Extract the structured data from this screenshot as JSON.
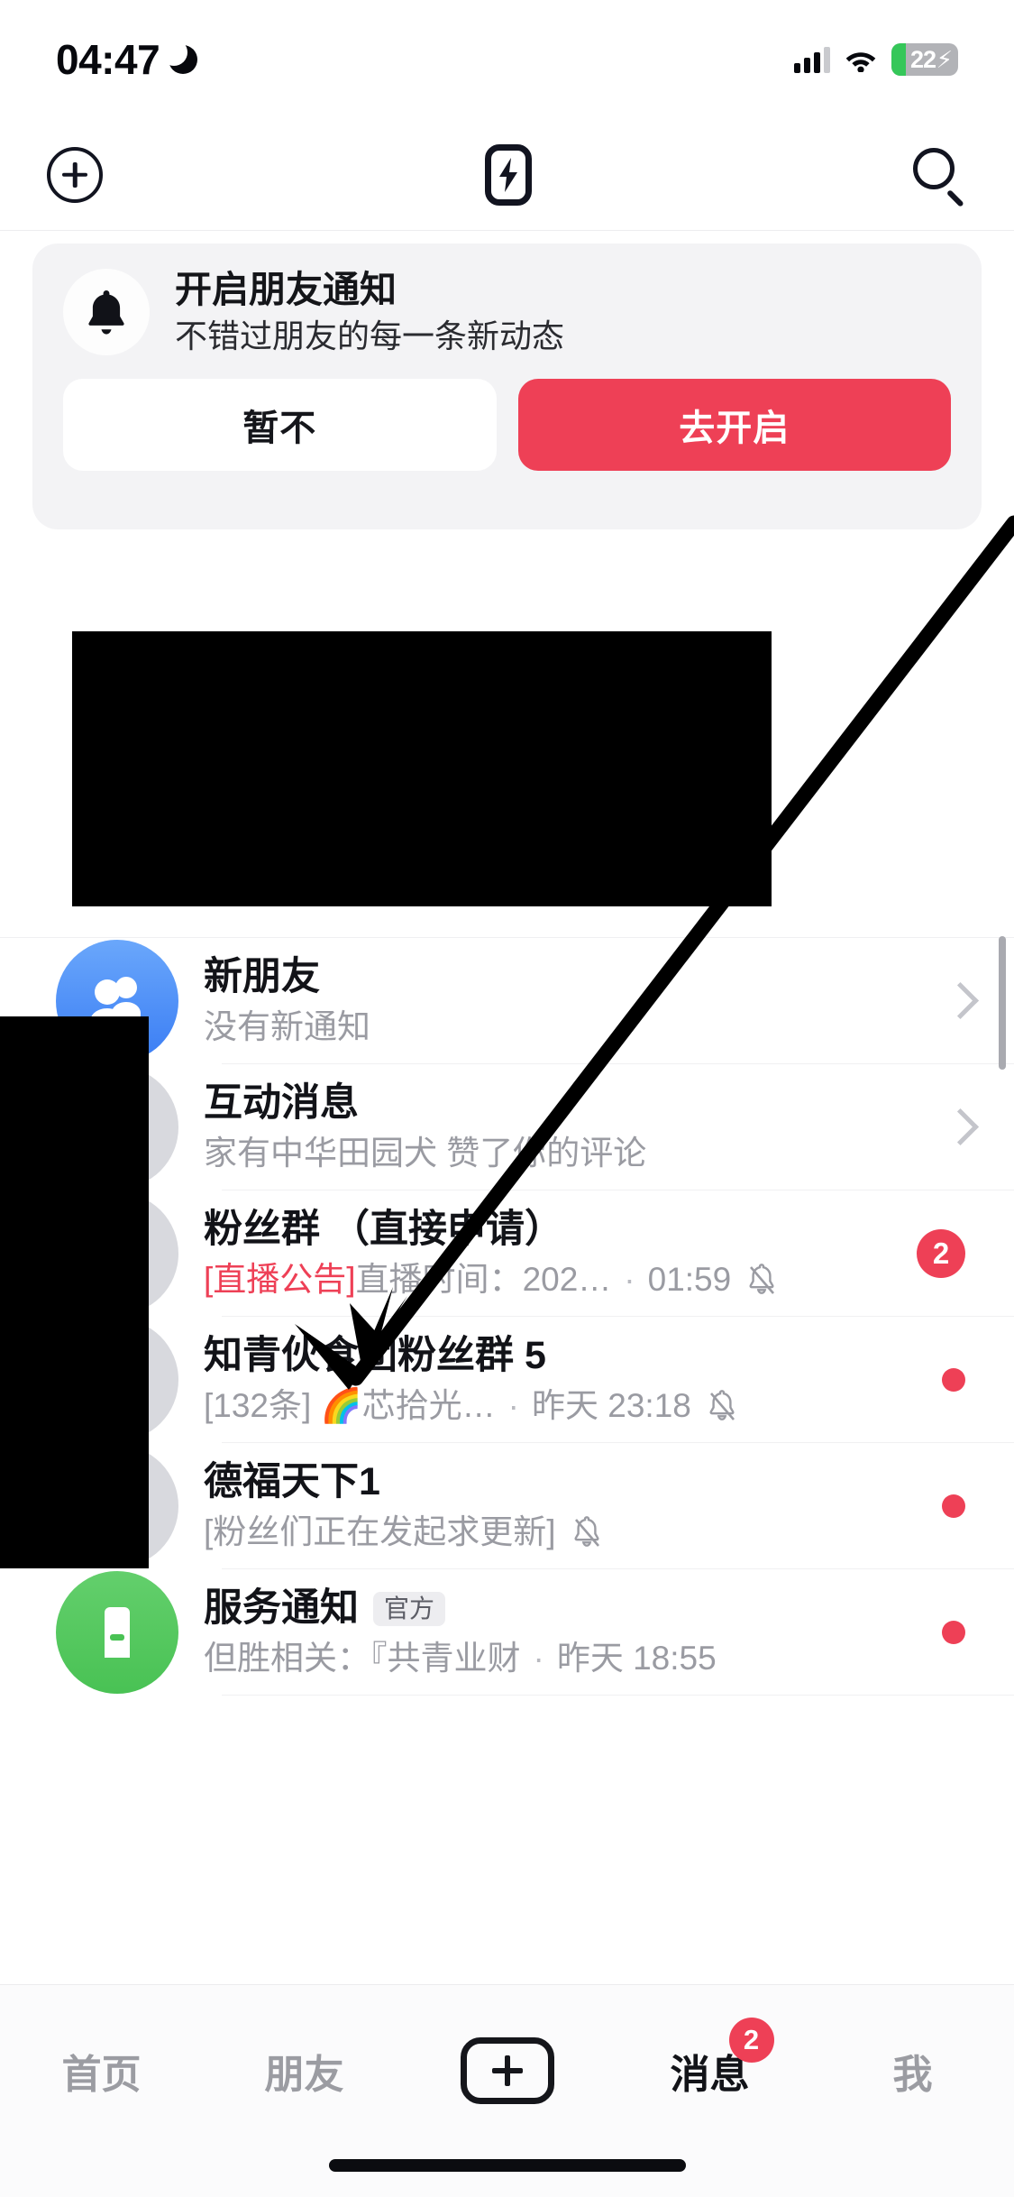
{
  "status_bar": {
    "time": "04:47",
    "dnd_icon": "moon-icon",
    "signal_icon": "cellular-signal-icon",
    "wifi_icon": "wifi-icon",
    "battery_percent": "22",
    "battery_charging": true,
    "battery_color": "#35c759"
  },
  "header": {
    "add_icon": "plus-circle-icon",
    "lightning_icon": "lightning-bolt-icon",
    "search_icon": "search-icon"
  },
  "notification_card": {
    "bell_icon": "bell-icon",
    "title": "开启朋友通知",
    "subtitle": "不错过朋友的每一条新动态",
    "dismiss_label": "暂不",
    "confirm_label": "去开启",
    "confirm_color": "#ee4056",
    "card_bg": "#f3f3f5"
  },
  "message_list": [
    {
      "avatar_icon": "new-friends-people-icon",
      "avatar_color": "#3a7df4",
      "title": "新朋友",
      "subtitle": "没有新通知",
      "accessory": "chevron-right-icon"
    },
    {
      "avatar_icon": "interaction-heart-icon",
      "avatar_color": "#d8d9de",
      "title": "互动消息",
      "subtitle": "家有中华田园犬 赞了你的评论",
      "accessory": "chevron-right-icon"
    },
    {
      "avatar_icon": "group-avatar-icon",
      "avatar_color": "#d8d9de",
      "title": "粉丝群 （直接申请）",
      "subtitle_tag": "[直播公告]",
      "subtitle_tag_color": "#ee4056",
      "subtitle": "直播时间：",
      "subtitle_truncated": "202…",
      "subtitle_separator": "·",
      "subtitle_time": "01:59",
      "mute_icon": "bell-off-icon",
      "badge": "2",
      "accessory": "badge"
    },
    {
      "avatar_icon": "group-avatar-icon",
      "avatar_color": "#d8d9de",
      "title": "知青伙食团粉丝群 5",
      "subtitle": "[132条] 🌈芯拾光…",
      "subtitle_separator": "·",
      "subtitle_time": "昨天 23:18",
      "mute_icon": "bell-off-icon",
      "accessory": "red-dot"
    },
    {
      "avatar_icon": "group-avatar-icon",
      "avatar_color": "#d8d9de",
      "title": "德福天下1",
      "subtitle": "[粉丝们正在发起求更新]",
      "mute_icon": "bell-off-icon",
      "accessory": "red-dot"
    },
    {
      "avatar_icon": "service-notice-icon",
      "avatar_color": "#49c254",
      "title": "服务通知",
      "title_tag": "官方",
      "subtitle": "但胜相关：『共青业财",
      "subtitle_separator": "·",
      "subtitle_time": "昨天 18:55",
      "accessory": "red-dot"
    }
  ],
  "tab_bar": {
    "tabs": [
      {
        "label": "首页",
        "active": false
      },
      {
        "label": "朋友",
        "active": false
      },
      {
        "label": "",
        "icon": "plus-box-icon",
        "active": false
      },
      {
        "label": "消息",
        "active": true,
        "badge": "2"
      },
      {
        "label": "我",
        "active": false
      }
    ]
  },
  "annotation": {
    "arrow_icon": "arrow-pointing-down-left",
    "arrow_color": "#000000"
  },
  "scrollbar": {
    "visible": true,
    "color": "#a9aab0"
  }
}
